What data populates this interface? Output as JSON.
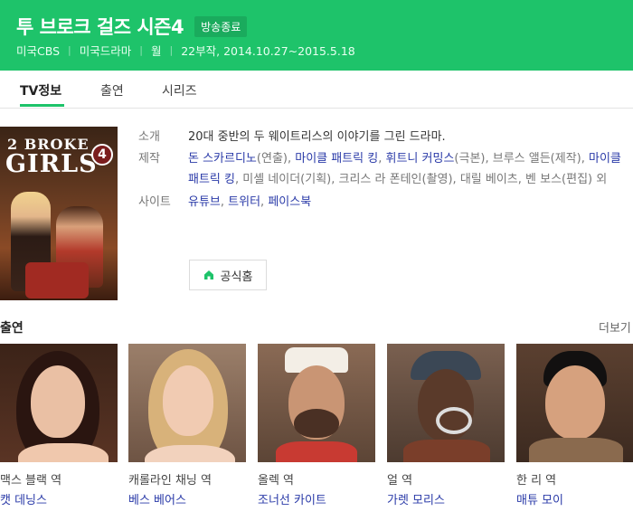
{
  "header": {
    "title": "투 브로크 걸즈 시즌4",
    "status_badge": "방송종료",
    "meta": [
      "미국CBS",
      "미국드라마",
      "월",
      "22부작, 2014.10.27~2015.5.18"
    ]
  },
  "tabs": [
    {
      "label": "TV정보",
      "active": true
    },
    {
      "label": "출연",
      "active": false
    },
    {
      "label": "시리즈",
      "active": false
    }
  ],
  "poster": {
    "title_line1": "2 BROKE",
    "title_line2": "GIRLS",
    "season_number": "4"
  },
  "info": {
    "intro_label": "소개",
    "intro_text": "20대 중반의 두 웨이트리스의 이야기를 그린 드라마.",
    "production_label": "제작",
    "production": {
      "p1": "돈 스카르디노",
      "r1": "(연출), ",
      "p2": "마이클 패트릭 킹",
      "s2": ", ",
      "p3": "휘트니 커밍스",
      "r3": "(극본), 브루스 앨든(제작), ",
      "p4": "마이클 패트릭 킹",
      "r4": ", 미셸 네이더(기획), 크리스 라 폰테인(촬영), 대릴 베이츠, 벤 보스(편집) 외"
    },
    "site_label": "사이트",
    "sites": [
      "유튜브",
      "트위터",
      "페이스북"
    ],
    "home_button": "공식홈"
  },
  "cast": {
    "section_title": "출연",
    "more_label": "더보기",
    "members": [
      {
        "role": "맥스 블랙 역",
        "name": "캣 데닝스"
      },
      {
        "role": "캐롤라인 채닝 역",
        "name": "베스 베어스"
      },
      {
        "role": "올렉 역",
        "name": "조너선 카이트"
      },
      {
        "role": "얼 역",
        "name": "가렛 모리스"
      },
      {
        "role": "한 리 역",
        "name": "매튜 모이"
      }
    ]
  },
  "colors": {
    "accent": "#1ec36a",
    "link": "#2a3aa8"
  }
}
